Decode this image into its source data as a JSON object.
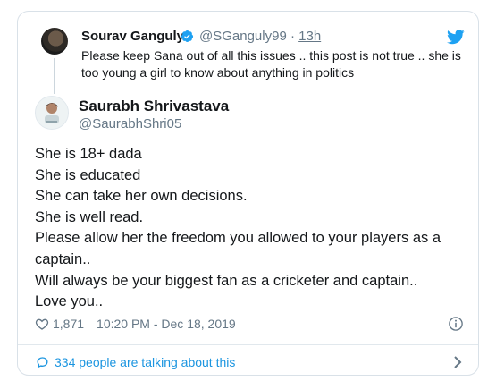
{
  "parent": {
    "name": "Sourav Ganguly",
    "handle": "@SGanguly99",
    "separator": "·",
    "time": "13h",
    "text": "Please keep Sana out of all this issues .. this post is not true .. she is too young a girl to know about anything in politics"
  },
  "author": {
    "name": "Saurabh Shrivastava",
    "handle": "@SaurabhShri05"
  },
  "tweet_lines": [
    "She is 18+ dada",
    "She is educated",
    "She can take her own decisions.",
    "She is well read.",
    "Please allow her the freedom you allowed to your players as a captain..",
    "Will always be your biggest fan as a cricketer and captain..",
    "Love you.."
  ],
  "meta": {
    "likes": "1,871",
    "timestamp": "10:20 PM - Dec 18, 2019"
  },
  "footer": {
    "talking_text": "334 people are talking about this"
  },
  "colors": {
    "link": "#1b95e0",
    "muted": "#657786",
    "verified": "#1da1f2",
    "twitter_brand": "#1da1f2"
  },
  "icons": [
    "verified-badge-icon",
    "twitter-bird-icon",
    "heart-icon",
    "info-icon",
    "speech-bubble-icon",
    "chevron-right-icon"
  ]
}
